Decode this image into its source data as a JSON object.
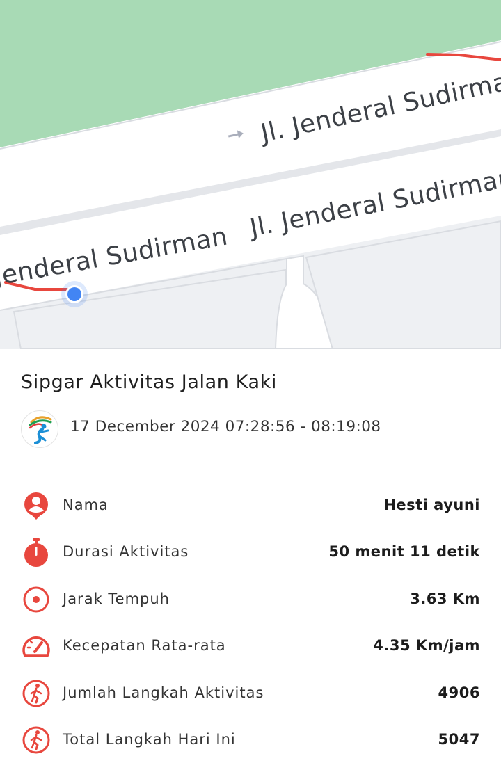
{
  "map": {
    "road_label_upper": "Jl. Jenderal Sudirman",
    "road_label_middle": "Jl. Jenderal Sudirman",
    "road_label_left": "Jenderal Sudirman",
    "colors": {
      "park": "#a8dab5",
      "route": "#e8473e",
      "location_dot": "#4285f4"
    }
  },
  "activity": {
    "title": "Sipgar Aktivitas Jalan Kaki",
    "datetime": "17 December 2024 07:28:56 - 08:19:08",
    "logo_icon": "sipgar-logo-icon"
  },
  "stats": [
    {
      "icon": "person-icon",
      "label": "Nama",
      "value": "Hesti ayuni"
    },
    {
      "icon": "stopwatch-icon",
      "label": "Durasi Aktivitas",
      "value": "50 menit 11 detik"
    },
    {
      "icon": "target-icon",
      "label": "Jarak Tempuh",
      "value": "3.63 Km"
    },
    {
      "icon": "speedometer-icon",
      "label": "Kecepatan Rata-rata",
      "value": "4.35 Km/jam"
    },
    {
      "icon": "walking-icon",
      "label": "Jumlah Langkah Aktivitas",
      "value": "4906"
    },
    {
      "icon": "walking-icon",
      "label": "Total Langkah Hari Ini",
      "value": "5047"
    }
  ],
  "accent_color": "#e8473e"
}
